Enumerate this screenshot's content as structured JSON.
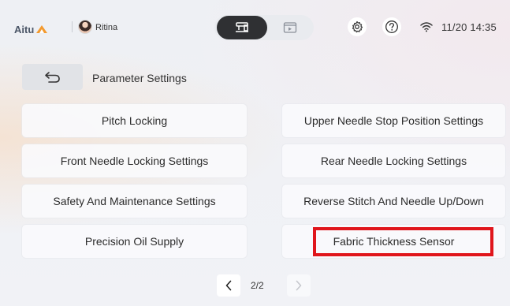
{
  "header": {
    "brand": "Aitu",
    "user_name": "Ritina",
    "time": "11/20 14:35"
  },
  "icons": {
    "mode_active": "sewing-machine-icon",
    "mode_inactive": "video-icon",
    "settings": "gear-icon",
    "help": "question-icon",
    "wifi": "wifi-icon",
    "back": "back-arrow-icon"
  },
  "page": {
    "title": "Parameter Settings"
  },
  "settings": {
    "items": [
      {
        "label": "Pitch Locking"
      },
      {
        "label": "Upper Needle Stop Position Settings"
      },
      {
        "label": "Front Needle Locking Settings"
      },
      {
        "label": "Rear Needle Locking Settings"
      },
      {
        "label": "Safety And Maintenance Settings"
      },
      {
        "label": "Reverse Stitch And Needle Up/Down"
      },
      {
        "label": "Precision Oil Supply"
      },
      {
        "label": "Fabric Thickness Sensor"
      }
    ]
  },
  "pagination": {
    "text": "2/2"
  },
  "colors": {
    "highlight": "#e0161c",
    "brand_orange": "#f39a2e",
    "active_mode": "#2f3033"
  }
}
